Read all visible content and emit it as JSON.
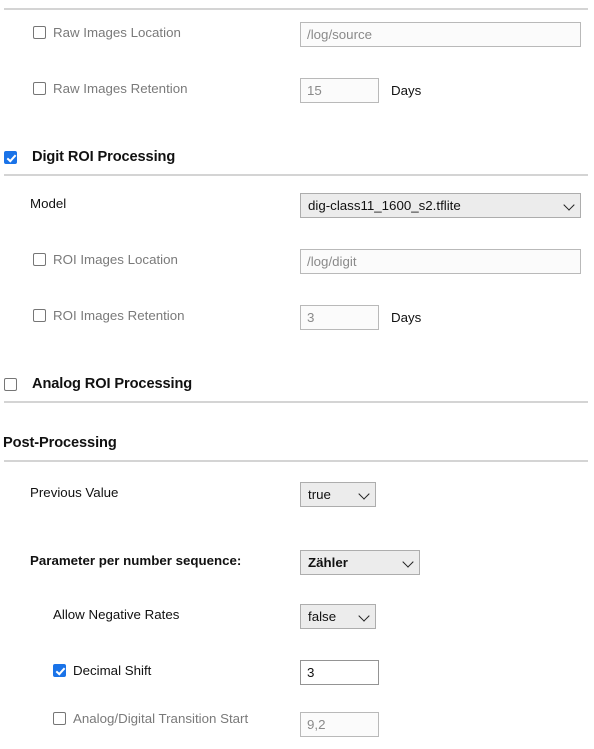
{
  "sections": {
    "raw_images": {
      "rows": [
        {
          "label": "Raw Images Location",
          "checkbox": "unchecked",
          "value": "/log/source",
          "unit": ""
        },
        {
          "label": "Raw Images Retention",
          "checkbox": "unchecked",
          "value": "15",
          "unit": "Days"
        }
      ]
    },
    "digit_roi": {
      "heading": "Digit ROI Processing",
      "checkbox": "checked",
      "model": {
        "label": "Model",
        "value": "dig-class11_1600_s2.tflite"
      },
      "rows": [
        {
          "label": "ROI Images Location",
          "checkbox": "unchecked",
          "value": "/log/digit",
          "unit": ""
        },
        {
          "label": "ROI Images Retention",
          "checkbox": "unchecked",
          "value": "3",
          "unit": "Days"
        }
      ]
    },
    "analog_roi": {
      "heading": "Analog ROI Processing",
      "checkbox": "unchecked"
    },
    "post_processing": {
      "heading": "Post-Processing",
      "previous_value": {
        "label": "Previous Value",
        "value": "true"
      },
      "parameter_per_sequence": {
        "label": "Parameter per number sequence:",
        "value": "Zähler"
      },
      "allow_negative_rates": {
        "label": "Allow Negative Rates",
        "value": "false"
      },
      "decimal_shift": {
        "label": "Decimal Shift",
        "checkbox": "checked",
        "value": "3"
      },
      "analog_digital_transition_start": {
        "label": "Analog/Digital Transition Start",
        "checkbox": "unchecked",
        "value": "9,2"
      }
    }
  },
  "icons": {
    "chevron_down": "chevron-down-icon",
    "checkmark": "checkmark-icon"
  },
  "colors": {
    "checkbox_checked": "#1a73e8",
    "divider": "#d4d4d4",
    "disabled_text": "#7a7a7a",
    "select_background": "#ececec"
  }
}
